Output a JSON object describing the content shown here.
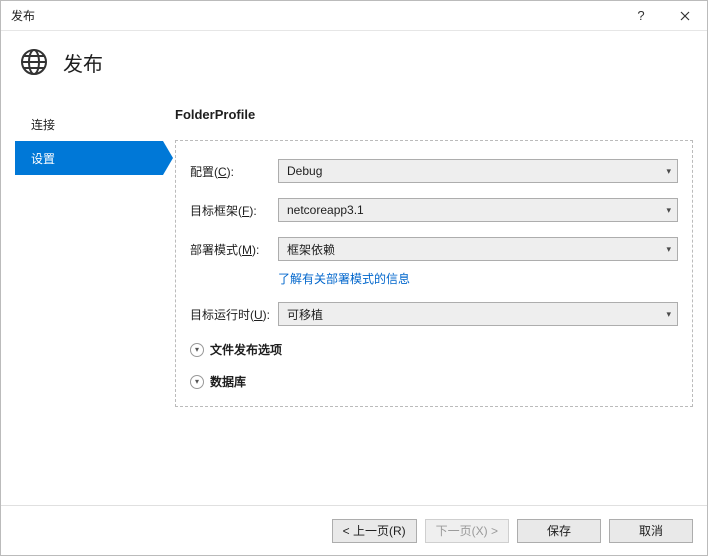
{
  "titlebar": {
    "title": "发布"
  },
  "header": {
    "title": "发布"
  },
  "sidebar": {
    "items": [
      {
        "label": "连接"
      },
      {
        "label": "设置"
      }
    ]
  },
  "main": {
    "profile_title": "FolderProfile",
    "fields": {
      "config": {
        "label_pre": "配置(",
        "label_u": "C",
        "label_post": "):",
        "value": "Debug"
      },
      "framework": {
        "label_pre": "目标框架(",
        "label_u": "F",
        "label_post": "):",
        "value": "netcoreapp3.1"
      },
      "deploy": {
        "label_pre": "部署模式(",
        "label_u": "M",
        "label_post": "):",
        "value": "框架依赖"
      },
      "runtime": {
        "label_pre": "目标运行时(",
        "label_u": "U",
        "label_post": "):",
        "value": "可移植"
      }
    },
    "learn_more_link": "了解有关部署模式的信息",
    "expanders": {
      "file_opts": "文件发布选项",
      "database": "数据库"
    }
  },
  "footer": {
    "prev": "< 上一页(R)",
    "next": "下一页(X) >",
    "save": "保存",
    "cancel": "取消"
  }
}
